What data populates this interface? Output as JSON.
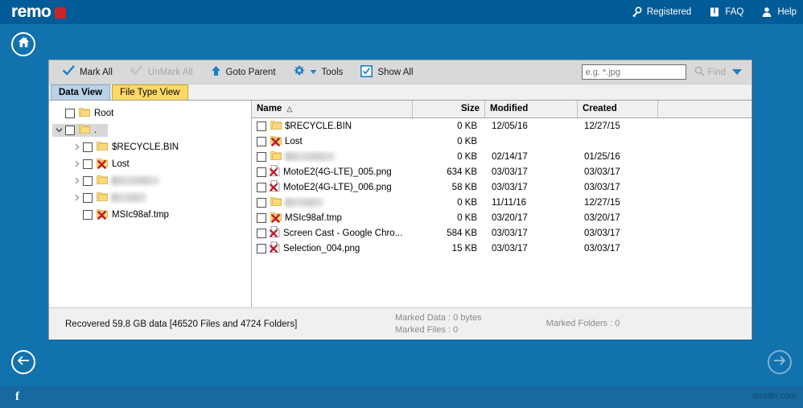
{
  "app": {
    "logo_text": "remo",
    "accent_blue": "#1272ae",
    "header_blue": "#005b96",
    "logo_red": "#c9242c"
  },
  "header": {
    "links": [
      {
        "label": "Registered",
        "icon": "key-icon"
      },
      {
        "label": "FAQ",
        "icon": "book-icon"
      },
      {
        "label": "Help",
        "icon": "person-icon"
      }
    ]
  },
  "home_button": {
    "icon": "home-icon"
  },
  "toolbar": {
    "mark_all": "Mark All",
    "unmark_all": "UnMark All",
    "goto_parent": "Goto Parent",
    "tools": "Tools",
    "show_all": "Show All",
    "search_placeholder": "e.g. *.jpg",
    "search_value": "",
    "find_label": "Find"
  },
  "tabs": [
    {
      "label": "Data View",
      "selected": true
    },
    {
      "label": "File Type View",
      "selected": false
    }
  ],
  "tree": [
    {
      "label": "Root",
      "indent": 0,
      "expander": "none",
      "icon": "folder-icon",
      "selected": false,
      "redacted": false
    },
    {
      "label": ".",
      "indent": 0,
      "expander": "down",
      "icon": "folder-icon",
      "selected": true,
      "redacted": false
    },
    {
      "label": "$RECYCLE.BIN",
      "indent": 1,
      "expander": "right",
      "icon": "folder-icon",
      "selected": false,
      "redacted": false
    },
    {
      "label": "Lost",
      "indent": 1,
      "expander": "right",
      "icon": "folder-deleted-icon",
      "selected": false,
      "redacted": false
    },
    {
      "label": "",
      "indent": 1,
      "expander": "right",
      "icon": "folder-icon",
      "selected": false,
      "redacted": true,
      "redact_width": 60
    },
    {
      "label": "",
      "indent": 1,
      "expander": "right",
      "icon": "folder-icon",
      "selected": false,
      "redacted": true,
      "redact_width": 44
    },
    {
      "label": "MSIc98af.tmp",
      "indent": 1,
      "expander": "none",
      "icon": "folder-deleted-icon",
      "selected": false,
      "redacted": false
    }
  ],
  "file_list": {
    "columns": [
      {
        "key": "name",
        "label": "Name",
        "sort": "asc"
      },
      {
        "key": "size",
        "label": "Size",
        "sort": ""
      },
      {
        "key": "modified",
        "label": "Modified",
        "sort": ""
      },
      {
        "key": "created",
        "label": "Created",
        "sort": ""
      }
    ],
    "rows": [
      {
        "name": "$RECYCLE.BIN",
        "size": "0 KB",
        "modified": "12/05/16",
        "created": "12/27/15",
        "icon": "folder-icon",
        "redacted": false
      },
      {
        "name": "Lost",
        "size": "0 KB",
        "modified": "",
        "created": "",
        "icon": "folder-deleted-icon",
        "redacted": false
      },
      {
        "name": "",
        "size": "0 KB",
        "modified": "02/14/17",
        "created": "01/25/16",
        "icon": "folder-icon",
        "redacted": true,
        "redact_width": 62
      },
      {
        "name": "MotoE2(4G-LTE)_005.png",
        "size": "634 KB",
        "modified": "03/03/17",
        "created": "03/03/17",
        "icon": "file-deleted-icon",
        "redacted": false
      },
      {
        "name": "MotoE2(4G-LTE)_006.png",
        "size": "58 KB",
        "modified": "03/03/17",
        "created": "03/03/17",
        "icon": "file-deleted-icon",
        "redacted": false
      },
      {
        "name": "",
        "size": "0 KB",
        "modified": "11/11/16",
        "created": "12/27/15",
        "icon": "folder-icon",
        "redacted": true,
        "redact_width": 48
      },
      {
        "name": "MSIc98af.tmp",
        "size": "0 KB",
        "modified": "03/20/17",
        "created": "03/20/17",
        "icon": "folder-deleted-icon",
        "redacted": false
      },
      {
        "name": "Screen Cast - Google Chro...",
        "size": "584 KB",
        "modified": "03/03/17",
        "created": "03/03/17",
        "icon": "file-deleted-icon",
        "redacted": false
      },
      {
        "name": "Selection_004.png",
        "size": "15 KB",
        "modified": "03/03/17",
        "created": "03/03/17",
        "icon": "file-deleted-icon",
        "redacted": false
      }
    ]
  },
  "status": {
    "recovered": "Recovered 59.8 GB data [46520 Files and 4724 Folders]",
    "marked_data": "Marked Data : 0 bytes",
    "marked_files": "Marked Files : 0",
    "marked_folders": "Marked Folders : 0"
  },
  "footer": {
    "facebook": "f",
    "watermark": "wsxdn.com"
  }
}
